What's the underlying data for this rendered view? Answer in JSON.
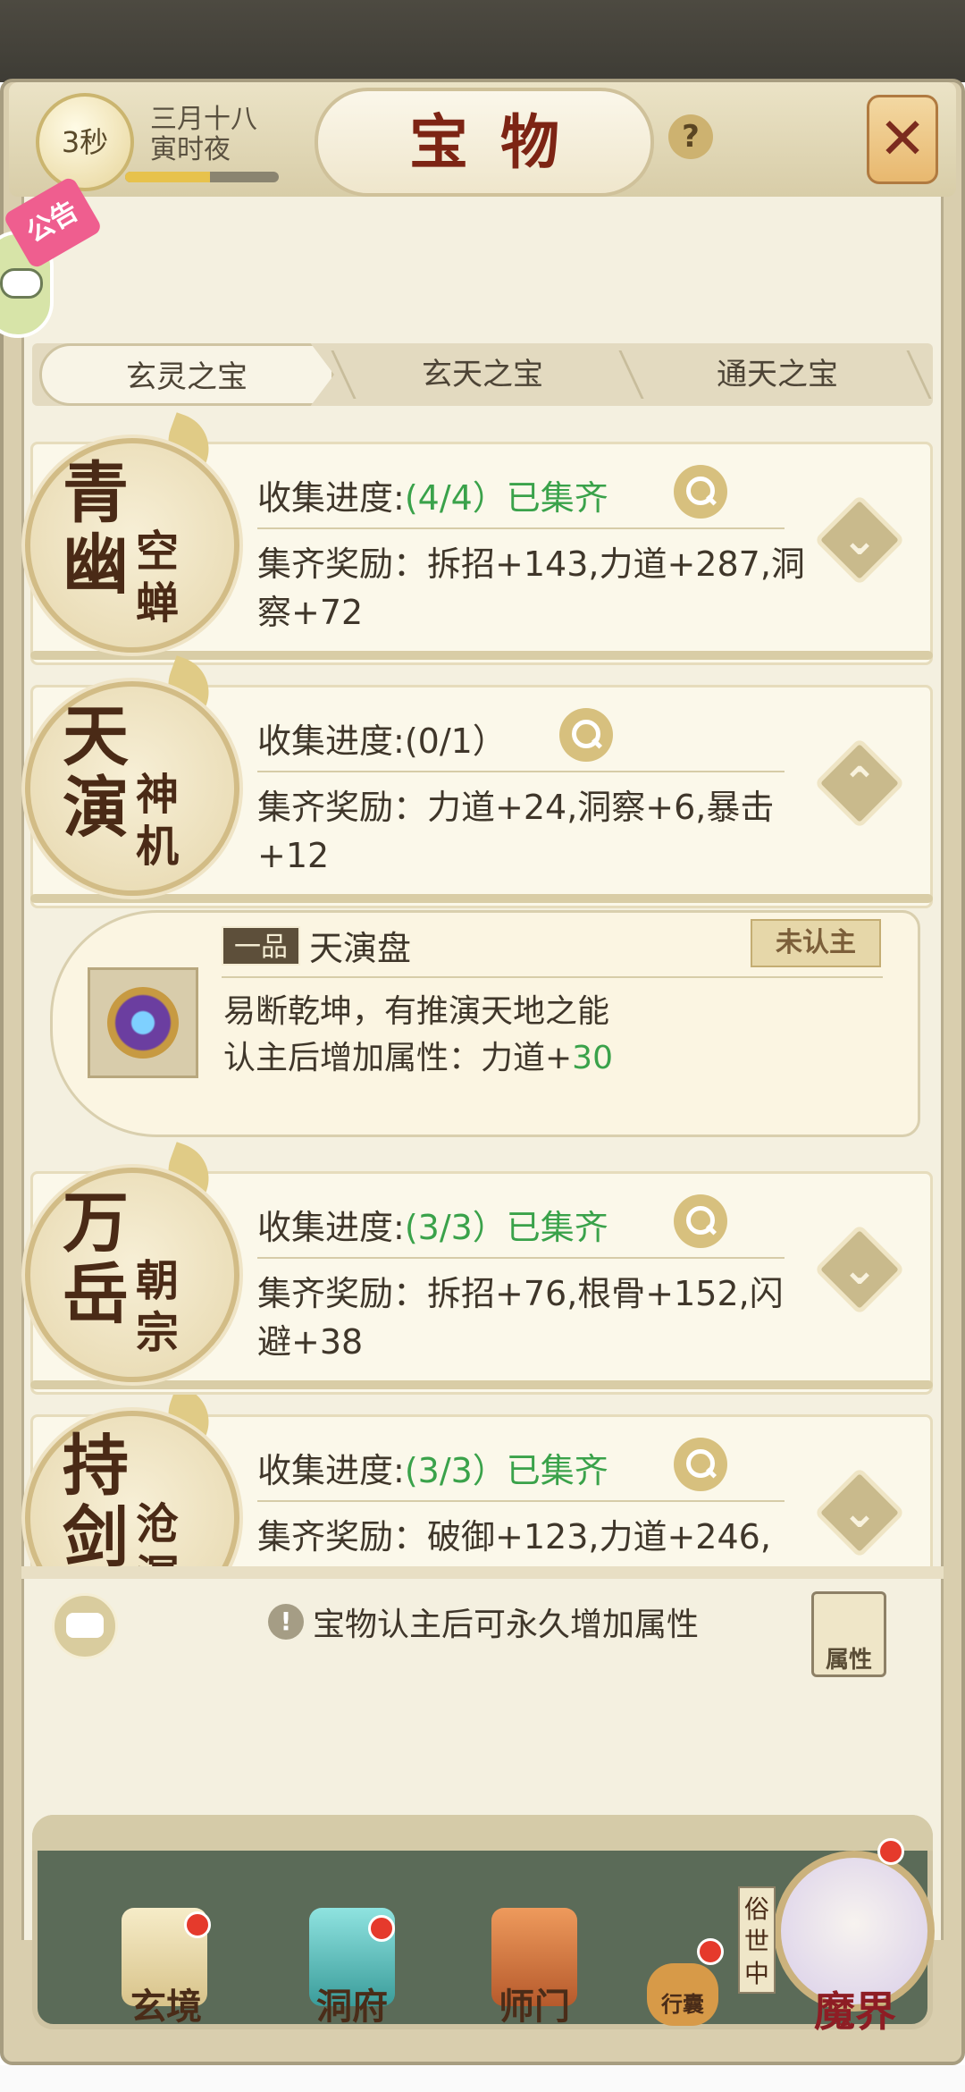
{
  "header": {
    "timer": "3秒",
    "date_line1": "三月十八",
    "date_line2": "寅时夜",
    "time_progress": 0.55,
    "title": "宝物",
    "help_glyph": "?",
    "close_glyph": "✕"
  },
  "side": {
    "notice_label": "公告"
  },
  "tabs": [
    {
      "label": "玄灵之宝",
      "active": true
    },
    {
      "label": "玄天之宝",
      "active": false
    },
    {
      "label": "通天之宝",
      "active": false
    }
  ],
  "collections": [
    {
      "medal_big": [
        "青",
        "幽"
      ],
      "medal_small": [
        "空",
        "蝉"
      ],
      "progress_label": "收集进度:",
      "progress_value": "(4/4）已集齐",
      "reward_label": "集齐奖励：",
      "reward_value": "拆招+143,力道+287,洞察+72",
      "expand_glyph": "⌄"
    },
    {
      "medal_big": [
        "天",
        "演"
      ],
      "medal_small": [
        "神",
        "机"
      ],
      "progress_label": "收集进度:",
      "progress_value": "(0/1）",
      "reward_label": "集齐奖励：",
      "reward_value": "力道+24,洞察+6,暴击+12",
      "expand_glyph": "⌃"
    },
    {
      "medal_big": [
        "万",
        "岳"
      ],
      "medal_small": [
        "朝",
        "宗"
      ],
      "progress_label": "收集进度:",
      "progress_value": "(3/3）已集齐",
      "reward_label": "集齐奖励：",
      "reward_value": "拆招+76,根骨+152,闪避+38",
      "expand_glyph": "⌄"
    },
    {
      "medal_big": [
        "持",
        "剑"
      ],
      "medal_small": [
        "沧",
        "溟"
      ],
      "progress_label": "收集进度:",
      "progress_value": "(3/3）已集齐",
      "reward_label": "集齐奖励：",
      "reward_value": "破御+123,力道+246,",
      "expand_glyph": "⌄"
    }
  ],
  "detail": {
    "grade": "一品",
    "name": "天演盘",
    "status": "未认主",
    "description": "易断乾坤，有推演天地之能",
    "attr_label": "认主后增加属性：力道+",
    "attr_value": "30"
  },
  "footer": {
    "hint_glyph": "!",
    "hint": "宝物认主后可永久增加属性",
    "attr_button": "属性"
  },
  "nav": [
    {
      "label": "玄境",
      "badge": true
    },
    {
      "label": "洞府",
      "badge": true
    },
    {
      "label": "师门",
      "badge": false
    },
    {
      "label": "行囊",
      "badge": true
    },
    {
      "label": "魔界",
      "badge": true
    }
  ],
  "nav_extra": {
    "mortal_tag": "俗世中"
  },
  "colors": {
    "title": "#7d2414",
    "complete_green": "#3aa24a",
    "panel_bg": "#f4f0e0",
    "nav_bg": "#5b6b58"
  }
}
